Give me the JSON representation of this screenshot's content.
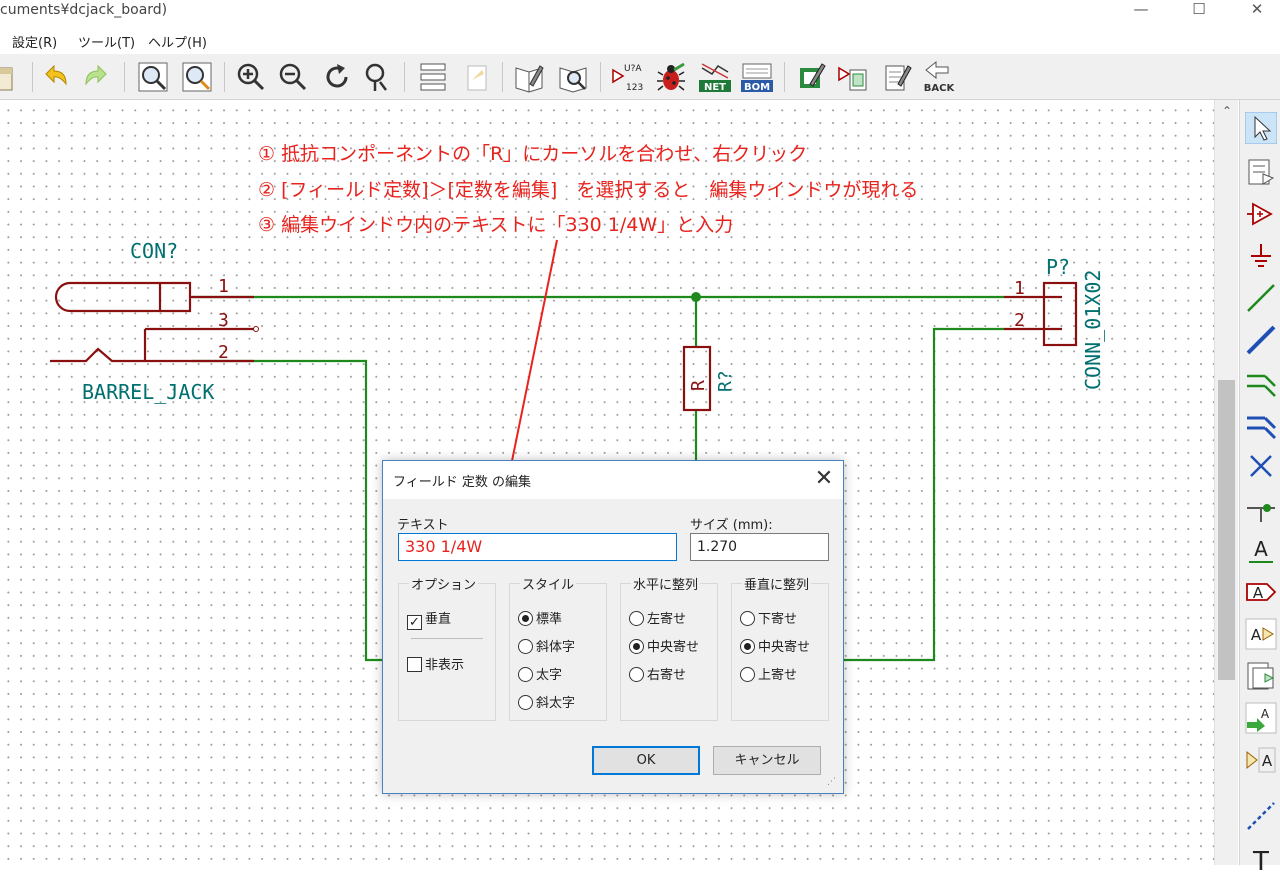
{
  "window": {
    "title": "cuments¥dcjack_board)",
    "minimize": "—",
    "maximize": "☐",
    "close": "✕"
  },
  "menu": [
    "設定(R)",
    "ツール(T)",
    "ヘルプ(H)"
  ],
  "toolbar": {
    "items": [
      "open-file",
      "undo",
      "redo",
      "zoom-fit",
      "zoom-page",
      "zoom-in",
      "zoom-out",
      "redraw",
      "zoom-selection",
      "hierarchy-navigator",
      "leave-sheet",
      "library-editor",
      "library-browser",
      "annotate",
      "erc",
      "netlist",
      "bom",
      "assign-footprints",
      "import-footprints",
      "bus-editor",
      "back-to-pcb"
    ],
    "annotate_label_top": "U?A",
    "annotate_label_bottom": "123",
    "netlist_label": "NET",
    "bom_label": "BOM",
    "back_label": "BACK"
  },
  "right_tools": [
    "select",
    "hierarchy",
    "add-component",
    "add-power",
    "wire",
    "bus",
    "wire-bus-entry",
    "bus-bus-entry",
    "no-connect",
    "junction",
    "net-label",
    "global-label",
    "hierarchical-label",
    "hierarchical-sheet",
    "import-pin",
    "sheet-pin",
    "graphic-line",
    "text"
  ],
  "annotations": [
    "① 抵抗コンポーネントの「R」にカーソルを合わせ、右クリック",
    "② [フィールド定数]＞[定数を編集]　を選択すると　編集ウインドウが現れる",
    "③ 編集ウインドウ内のテキストに「330 1/4W」と入力"
  ],
  "schematic": {
    "jack_ref": "CON?",
    "jack_value": "BARREL_JACK",
    "jack_pins": [
      "1",
      "3",
      "2"
    ],
    "connector_ref": "P?",
    "connector_value": "CONN_01X02",
    "connector_pins": [
      "1",
      "2"
    ],
    "resistor_ref": "R?",
    "resistor_value": "R"
  },
  "dialog": {
    "title": "フィールド 定数 の編集",
    "close": "✕",
    "text_label": "テキスト",
    "text_value": "330 1/4W",
    "size_label": "サイズ (mm):",
    "size_value": "1.270",
    "options": {
      "title": "オプション",
      "vertical": "垂直",
      "vertical_checked": true,
      "hidden": "非表示",
      "hidden_checked": false
    },
    "style": {
      "title": "スタイル",
      "items": [
        "標準",
        "斜体字",
        "太字",
        "斜太字"
      ],
      "selected": 0
    },
    "halign": {
      "title": "水平に整列",
      "items": [
        "左寄せ",
        "中央寄せ",
        "右寄せ"
      ],
      "selected": 1
    },
    "valign": {
      "title": "垂直に整列",
      "items": [
        "下寄せ",
        "中央寄せ",
        "上寄せ"
      ],
      "selected": 1
    },
    "ok": "OK",
    "cancel": "キャンセル"
  }
}
